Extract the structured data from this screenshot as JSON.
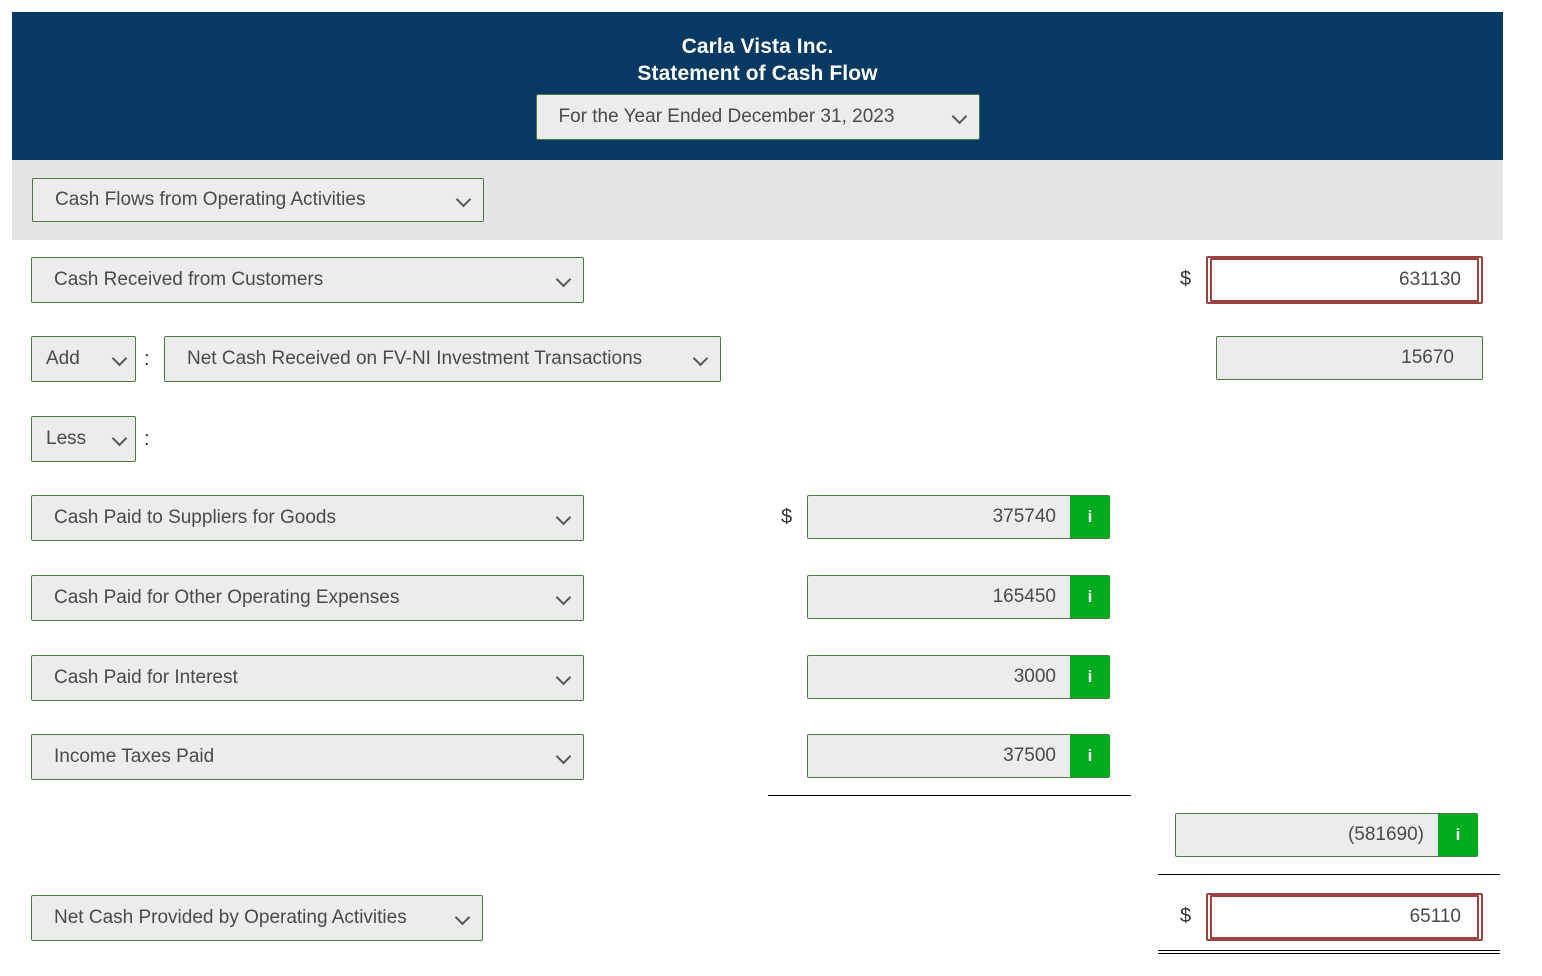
{
  "header": {
    "company": "Carla Vista Inc.",
    "statement_title": "Statement of Cash Flow",
    "period": "For the Year Ended December 31, 2023",
    "bg_color": "#083963"
  },
  "section": {
    "label": "Cash Flows from Operating Activities",
    "band_color": "#e4e4e4"
  },
  "colors": {
    "select_border": "#4a7a42",
    "select_bg": "#ececec",
    "info_green": "#00ab1e",
    "error_red": "#9c4242"
  },
  "symbols": {
    "dollar": "$",
    "colon": ":",
    "info": "i"
  },
  "rows": {
    "cash_received": {
      "label": "Cash Received from Customers",
      "value": "631130"
    },
    "add_row": {
      "operator": "Add",
      "label": "Net Cash Received on FV-NI Investment Transactions",
      "value": "15670"
    },
    "less_row": {
      "operator": "Less"
    },
    "suppliers": {
      "label": "Cash Paid to Suppliers for Goods",
      "value": "375740"
    },
    "other_operating": {
      "label": "Cash Paid for Other Operating Expenses",
      "value": "165450"
    },
    "interest": {
      "label": "Cash Paid for Interest",
      "value": "3000"
    },
    "income_taxes": {
      "label": "Income Taxes Paid",
      "value": "37500"
    },
    "subtotal": {
      "value": "(581690)"
    },
    "net_cash": {
      "label": "Net Cash Provided by Operating Activities",
      "value": "65110"
    }
  }
}
